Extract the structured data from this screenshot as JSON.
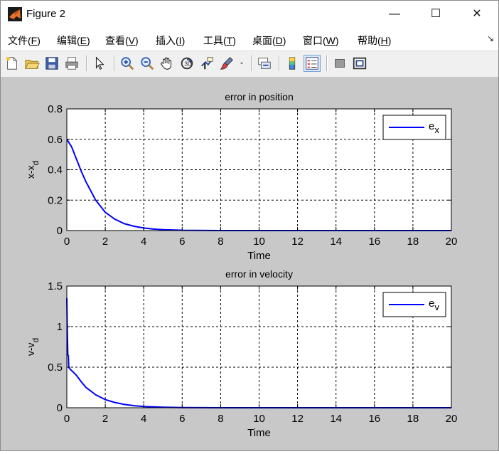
{
  "window": {
    "title": "Figure 2",
    "minimize": "—",
    "maximize": "☐",
    "close": "✕"
  },
  "menu": [
    {
      "label": "文件(",
      "acc": "F",
      "end": ")"
    },
    {
      "label": "编辑(",
      "acc": "E",
      "end": ")"
    },
    {
      "label": "查看(",
      "acc": "V",
      "end": ")"
    },
    {
      "label": "插入(",
      "acc": "I",
      "end": ")"
    },
    {
      "label": "工具(",
      "acc": "T",
      "end": ")"
    },
    {
      "label": "桌面(",
      "acc": "D",
      "end": ")"
    },
    {
      "label": "窗口(",
      "acc": "W",
      "end": ")"
    },
    {
      "label": "帮助(",
      "acc": "H",
      "end": ")"
    }
  ],
  "toolbar": [
    "new-file-icon",
    "open-folder-icon",
    "save-icon",
    "print-icon",
    "|",
    "pointer-icon",
    "|",
    "zoom-in-icon",
    "zoom-out-icon",
    "pan-hand-icon",
    "rotate-3d-icon",
    "data-cursor-icon",
    "brush-icon",
    "brush-dropdown-icon",
    "|",
    "link-plot-icon",
    "|",
    "colorbar-icon",
    "legend-icon",
    "|",
    "hide-plot-tools-icon",
    "show-plot-tools-icon"
  ],
  "colors": {
    "line": "#0000ff",
    "figure_bg": "#c8c8c8",
    "axes_bg": "#ffffff"
  },
  "chart_data": [
    {
      "type": "line",
      "title": "error in position",
      "xlabel": "Time",
      "ylabel": "x-x",
      "ylabel_sub": "d",
      "xlim": [
        0,
        20
      ],
      "ylim": [
        0,
        0.8
      ],
      "xticks": [
        "0",
        "2",
        "4",
        "6",
        "8",
        "10",
        "12",
        "14",
        "16",
        "18",
        "20"
      ],
      "yticks": [
        "0",
        "0.2",
        "0.4",
        "0.6",
        "0.8"
      ],
      "grid": true,
      "legend": {
        "position": "top-right",
        "label": "e",
        "sub": "x"
      },
      "series": [
        {
          "name": "e_x",
          "x": [
            0,
            0.25,
            0.5,
            0.75,
            1,
            1.25,
            1.5,
            1.75,
            2,
            2.5,
            3,
            3.5,
            4,
            4.5,
            5,
            6,
            8,
            10,
            12,
            14,
            16,
            18,
            20
          ],
          "y": [
            0.6,
            0.55,
            0.47,
            0.39,
            0.32,
            0.26,
            0.2,
            0.16,
            0.12,
            0.075,
            0.045,
            0.028,
            0.017,
            0.01,
            0.006,
            0.002,
            0,
            0,
            0,
            0,
            0,
            0,
            0
          ]
        }
      ]
    },
    {
      "type": "line",
      "title": "error in velocity",
      "xlabel": "Time",
      "ylabel": "v-v",
      "ylabel_sub": "d",
      "xlim": [
        0,
        20
      ],
      "ylim": [
        0,
        1.5
      ],
      "xticks": [
        "0",
        "2",
        "4",
        "6",
        "8",
        "10",
        "12",
        "14",
        "16",
        "18",
        "20"
      ],
      "yticks": [
        "0",
        "0.5",
        "1",
        "1.5"
      ],
      "grid": true,
      "legend": {
        "position": "top-right",
        "label": "e",
        "sub": "v"
      },
      "series": [
        {
          "name": "e_v",
          "x": [
            0,
            0.02,
            0.05,
            0.08,
            0.1,
            0.15,
            0.2,
            0.5,
            0.75,
            1,
            1.5,
            2,
            2.5,
            3,
            3.5,
            4,
            5,
            6,
            8,
            10,
            12,
            14,
            16,
            18,
            20
          ],
          "y": [
            1.35,
            1.05,
            0.65,
            0.64,
            0.5,
            0.48,
            0.47,
            0.4,
            0.32,
            0.25,
            0.16,
            0.1,
            0.065,
            0.04,
            0.025,
            0.016,
            0.006,
            0.002,
            0,
            0,
            0,
            0,
            0,
            0,
            0
          ]
        }
      ]
    }
  ]
}
